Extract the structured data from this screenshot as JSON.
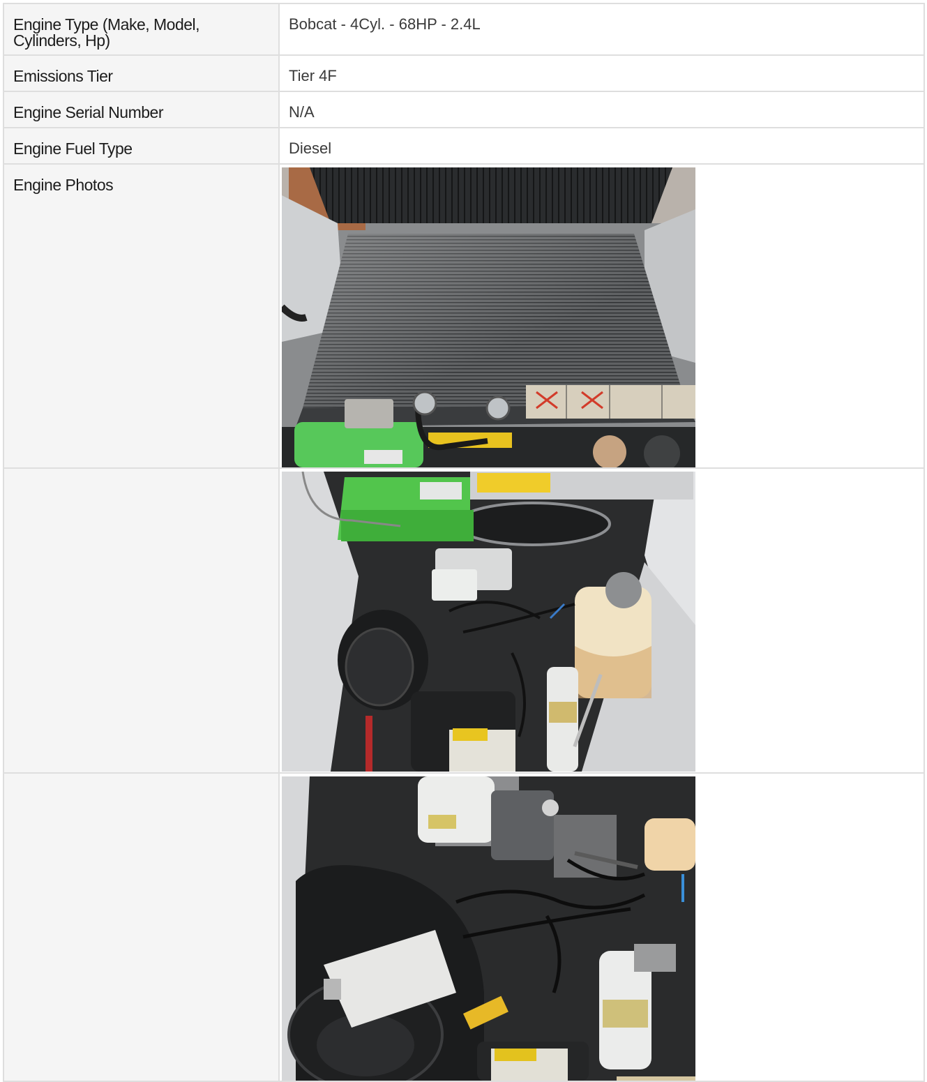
{
  "specs": {
    "engine_type": {
      "label": "Engine Type (Make, Model, Cylinders, Hp)",
      "value": "Bobcat - 4Cyl. - 68HP - 2.4L"
    },
    "emissions_tier": {
      "label": "Emissions Tier",
      "value": "Tier 4F"
    },
    "engine_serial": {
      "label": "Engine Serial Number",
      "value": "N/A"
    },
    "fuel_type": {
      "label": "Engine Fuel Type",
      "value": "Diesel"
    },
    "photos": {
      "label": "Engine Photos"
    }
  },
  "colors": {
    "label_bg": "#f5f5f5",
    "border": "#dedede",
    "label_text": "#1c1c1c",
    "value_text": "#3a3a3a"
  }
}
